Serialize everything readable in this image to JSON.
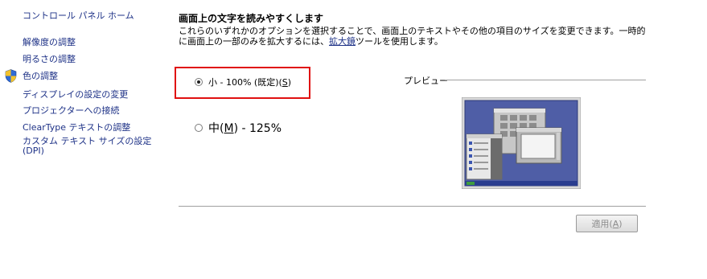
{
  "sidebar": {
    "home": "コントロール パネル ホーム",
    "items": [
      {
        "label": "解像度の調整"
      },
      {
        "label": "明るさの調整"
      },
      {
        "label": "色の調整",
        "icon": "shield-icon"
      },
      {
        "label": "ディスプレイの設定の変更"
      },
      {
        "label": "プロジェクターへの接続"
      },
      {
        "label": "ClearType テキストの調整"
      },
      {
        "label": "カスタム テキスト サイズの設定\n(DPI)"
      }
    ]
  },
  "main": {
    "title": "画面上の文字を読みやすくします",
    "description_before": "これらのいずれかのオプションを選択することで、画面上のテキストやその他の項目のサイズを変更できます。一時的に画面上の一部のみを拡大するには、",
    "magnifier_link": "拡大鏡",
    "description_after": "ツールを使用します。",
    "options": [
      {
        "label_prefix": "小 - 100% (既定)(",
        "accel": "S",
        "label_suffix": ")",
        "selected": true
      },
      {
        "label_prefix": "中(",
        "accel": "M",
        "label_suffix": ") - 125%",
        "selected": false
      }
    ],
    "preview_label": "プレビュー",
    "apply_prefix": "適用(",
    "apply_accel": "A",
    "apply_suffix": ")"
  },
  "colors": {
    "highlight": "#e01010",
    "link": "#1e3287"
  }
}
